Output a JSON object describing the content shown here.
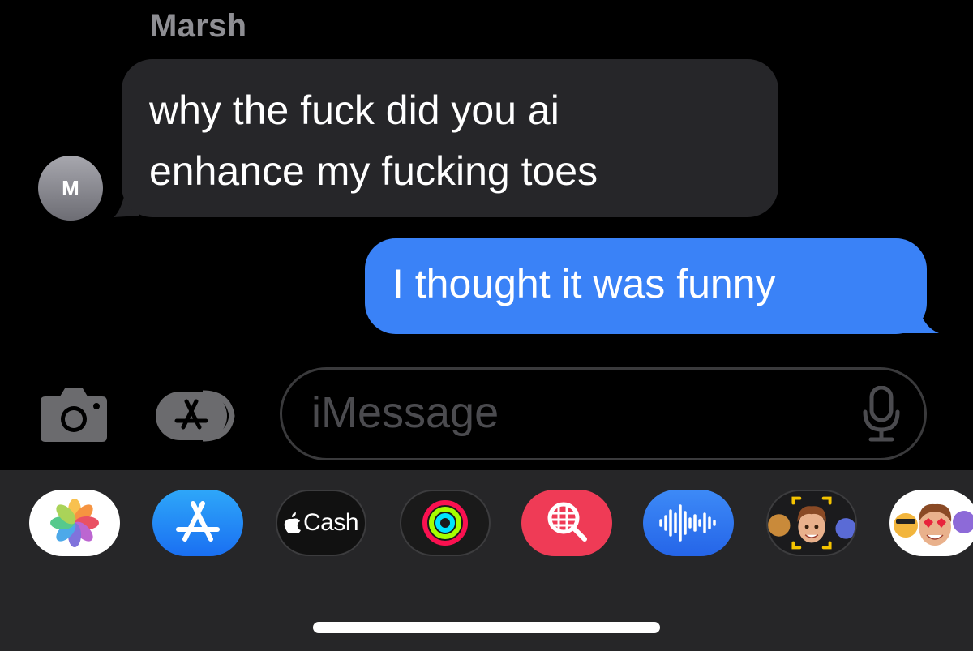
{
  "conversation": {
    "incoming": {
      "sender": "Marsh",
      "avatar_initial": "M",
      "lines": [
        "why the fuck did you ai",
        "enhance my fucking toes"
      ]
    },
    "outgoing": {
      "text": "I thought it was funny"
    }
  },
  "composer": {
    "placeholder": "iMessage",
    "camera_icon": "camera-icon",
    "apps_icon": "app-store-icon",
    "mic_icon": "microphone-icon"
  },
  "app_drawer": {
    "apps": [
      {
        "name": "Photos",
        "icon": "photos-icon"
      },
      {
        "name": "App Store",
        "icon": "app-store-icon"
      },
      {
        "name": "Apple Cash",
        "icon": "apple-cash-icon",
        "label": "Cash"
      },
      {
        "name": "Fitness",
        "icon": "activity-rings-icon"
      },
      {
        "name": "Images",
        "icon": "image-search-icon"
      },
      {
        "name": "Audio",
        "icon": "audio-message-icon"
      },
      {
        "name": "Memoji",
        "icon": "memoji-icon"
      },
      {
        "name": "Memoji Stickers",
        "icon": "memoji-stickers-icon"
      }
    ]
  },
  "colors": {
    "background": "#000000",
    "incoming_bubble": "#262629",
    "outgoing_bubble": "#3a82f7",
    "drawer": "#262628"
  }
}
